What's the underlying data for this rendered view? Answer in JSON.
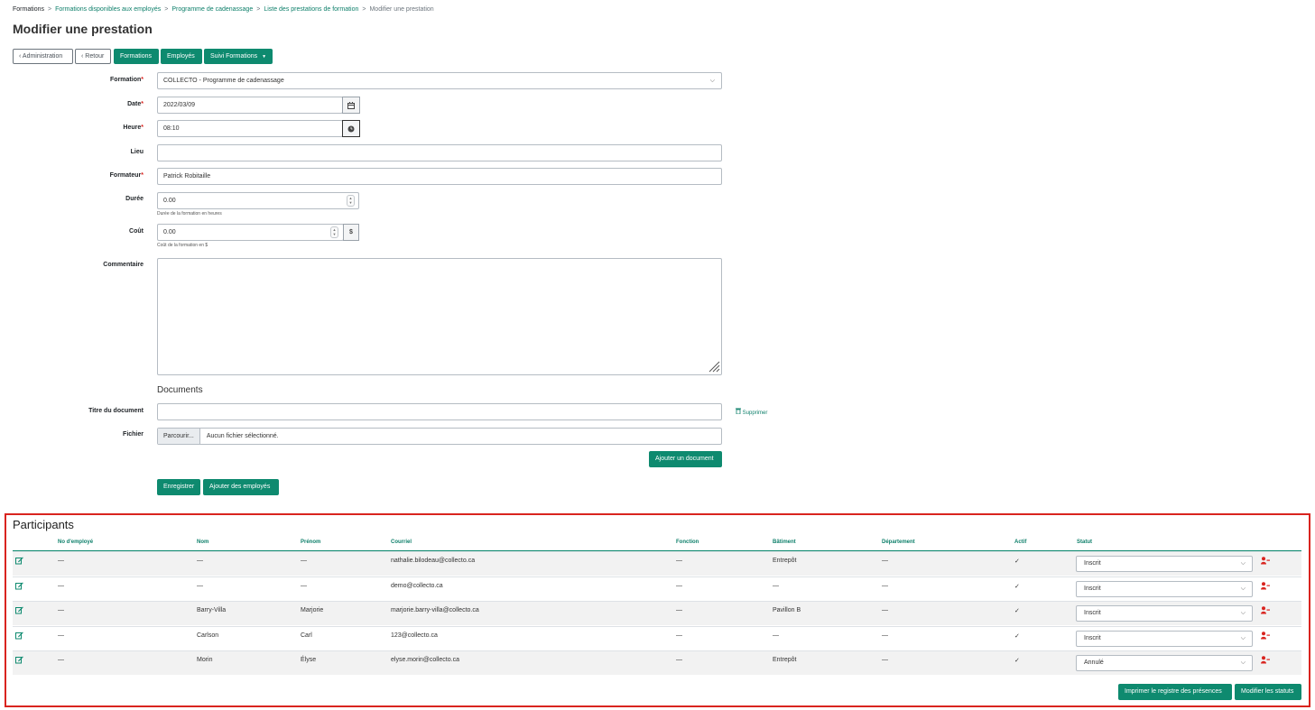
{
  "breadcrumb": [
    "Formations",
    "Formations disponibles aux employés",
    "Programme de cadenassage",
    "Liste des prestations de formation",
    "Modifier une prestation"
  ],
  "breadcrumb_sep": ">",
  "page_title": "Modifier une prestation",
  "toolbar": {
    "administration": "Administration",
    "retour": "Retour",
    "formations": "Formations",
    "employes": "Employés",
    "suivi": "Suivi Formations"
  },
  "form": {
    "formation_label": "Formation",
    "formation_value": "COLLECTO - Programme de cadenassage",
    "date_label": "Date",
    "date_value": "2022/03/09",
    "heure_label": "Heure",
    "heure_value": "08:10",
    "lieu_label": "Lieu",
    "lieu_value": "",
    "formateur_label": "Formateur",
    "formateur_value": "Patrick Robitaille",
    "duree_label": "Durée",
    "duree_value": "0.00",
    "duree_help": "Durée de la formation en heures",
    "cout_label": "Coût",
    "cout_value": "0.00",
    "cout_addon": "$",
    "cout_help": "Coût de la formation en $",
    "commentaire_label": "Commentaire",
    "commentaire_value": "",
    "required_mark": "*"
  },
  "documents": {
    "heading": "Documents",
    "titre_label": "Titre du document",
    "titre_value": "",
    "supprimer": "Supprimer",
    "fichier_label": "Fichier",
    "parcourir": "Parcourir...",
    "no_file": "Aucun fichier sélectionné.",
    "ajouter_document": "Ajouter un document"
  },
  "actions": {
    "enregistrer": "Enregistrer",
    "ajouter_employes": "Ajouter des employés"
  },
  "participants": {
    "title": "Participants",
    "columns": [
      "No d'employé",
      "Nom",
      "Prénom",
      "Courriel",
      "Fonction",
      "Bâtiment",
      "Département",
      "Actif",
      "Statut"
    ],
    "rows": [
      {
        "no": "—",
        "nom": "—",
        "prenom": "—",
        "courriel": "nathalie.bilodeau@collecto.ca",
        "fonction": "—",
        "batiment": "Entrepôt",
        "departement": "—",
        "actif": "✓",
        "statut": "Inscrit"
      },
      {
        "no": "—",
        "nom": "—",
        "prenom": "—",
        "courriel": "demo@collecto.ca",
        "fonction": "—",
        "batiment": "—",
        "departement": "—",
        "actif": "✓",
        "statut": "Inscrit"
      },
      {
        "no": "—",
        "nom": "Barry-Villa",
        "prenom": "Marjorie",
        "courriel": "marjorie.barry-villa@collecto.ca",
        "fonction": "—",
        "batiment": "Pavillon B",
        "departement": "—",
        "actif": "✓",
        "statut": "Inscrit"
      },
      {
        "no": "—",
        "nom": "Carlson",
        "prenom": "Carl",
        "courriel": "123@collecto.ca",
        "fonction": "—",
        "batiment": "—",
        "departement": "—",
        "actif": "✓",
        "statut": "Inscrit"
      },
      {
        "no": "—",
        "nom": "Morin",
        "prenom": "Élyse",
        "courriel": "elyse.morin@collecto.ca",
        "fonction": "—",
        "batiment": "Entrepôt",
        "departement": "—",
        "actif": "✓",
        "statut": "Annulé"
      }
    ],
    "imprimer": "Imprimer le registre des présences",
    "modifier_statuts": "Modifier les statuts"
  },
  "icons": {
    "back": "chevron-left-icon",
    "dropdown": "caret-down-icon",
    "calendar": "calendar-icon",
    "clock": "clock-icon",
    "trash": "trash-icon",
    "edit": "edit-icon",
    "remove_user": "user-minus-icon"
  },
  "colors": {
    "accent": "#0e8a6f",
    "link": "#0d7f6a",
    "danger": "#d9241f"
  }
}
